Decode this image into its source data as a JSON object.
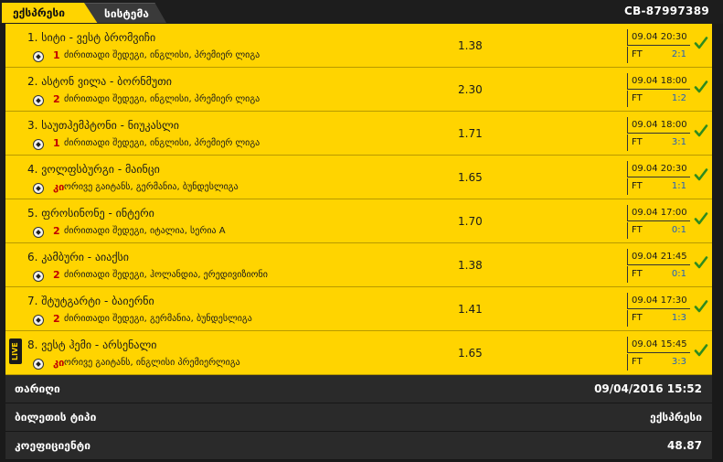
{
  "tabs": {
    "express": "ექსპრესი",
    "system": "სისტემა"
  },
  "ticket_id": "CB-87997389",
  "colors": {
    "accent": "#ffd400",
    "pick": "#c10000",
    "score": "#1f5fbf",
    "check": "#2e8b1e"
  },
  "bets": [
    {
      "title": "1. სიტი - ვესტ ბრომვიჩი",
      "pick": "1",
      "league": "ძირითადი შედეგი, ინგლისი, პრემიერ ლიგა",
      "odds": "1.38",
      "date": "09.04 20:30",
      "status": "FT",
      "score": "2:1",
      "live": ""
    },
    {
      "title": "2. ასტონ ვილა - ბორნმუთი",
      "pick": "2",
      "league": "ძირითადი შედეგი, ინგლისი, პრემიერ ლიგა",
      "odds": "2.30",
      "date": "09.04 18:00",
      "status": "FT",
      "score": "1:2",
      "live": ""
    },
    {
      "title": "3. საუთჰემპტონი - ნიუკასლი",
      "pick": "1",
      "league": "ძირითადი შედეგი, ინგლისი, პრემიერ ლიგა",
      "odds": "1.71",
      "date": "09.04 18:00",
      "status": "FT",
      "score": "3:1",
      "live": ""
    },
    {
      "title": "4. ვოლფსბურგი - მაინცი",
      "pick": "კი",
      "league": "ორივე გაიტანს, გერმანია, ბუნდესლიგა",
      "odds": "1.65",
      "date": "09.04 20:30",
      "status": "FT",
      "score": "1:1",
      "live": ""
    },
    {
      "title": "5. ფროსინონე - ინტერი",
      "pick": "2",
      "league": "ძირითადი შედეგი, იტალია, სერია A",
      "odds": "1.70",
      "date": "09.04 17:00",
      "status": "FT",
      "score": "0:1",
      "live": ""
    },
    {
      "title": "6. კამბური - აიაქსი",
      "pick": "2",
      "league": "ძირითადი შედეგი, ჰოლანდია, ერედივიზიონი",
      "odds": "1.38",
      "date": "09.04 21:45",
      "status": "FT",
      "score": "0:1",
      "live": ""
    },
    {
      "title": "7. შტუტგარტი - ბაიერნი",
      "pick": "2",
      "league": "ძირითადი შედეგი, გერმანია, ბუნდესლიგა",
      "odds": "1.41",
      "date": "09.04 17:30",
      "status": "FT",
      "score": "1:3",
      "live": ""
    },
    {
      "title": "8. ვესტ ჰემი - არსენალი",
      "pick": "კი",
      "league": "ორივე გაიტანს, ინგლისი პრემიერლიგა",
      "odds": "1.65",
      "date": "09.04 15:45",
      "status": "FT",
      "score": "3:3",
      "live": "LIVE"
    }
  ],
  "summary": {
    "date_label": "თარიღი",
    "date_value": "09/04/2016 15:52",
    "type_label": "ბილეთის ტიპი",
    "type_value": "ექსპრესი",
    "coef_label": "კოეფიციენტი",
    "coef_value": "48.87"
  }
}
